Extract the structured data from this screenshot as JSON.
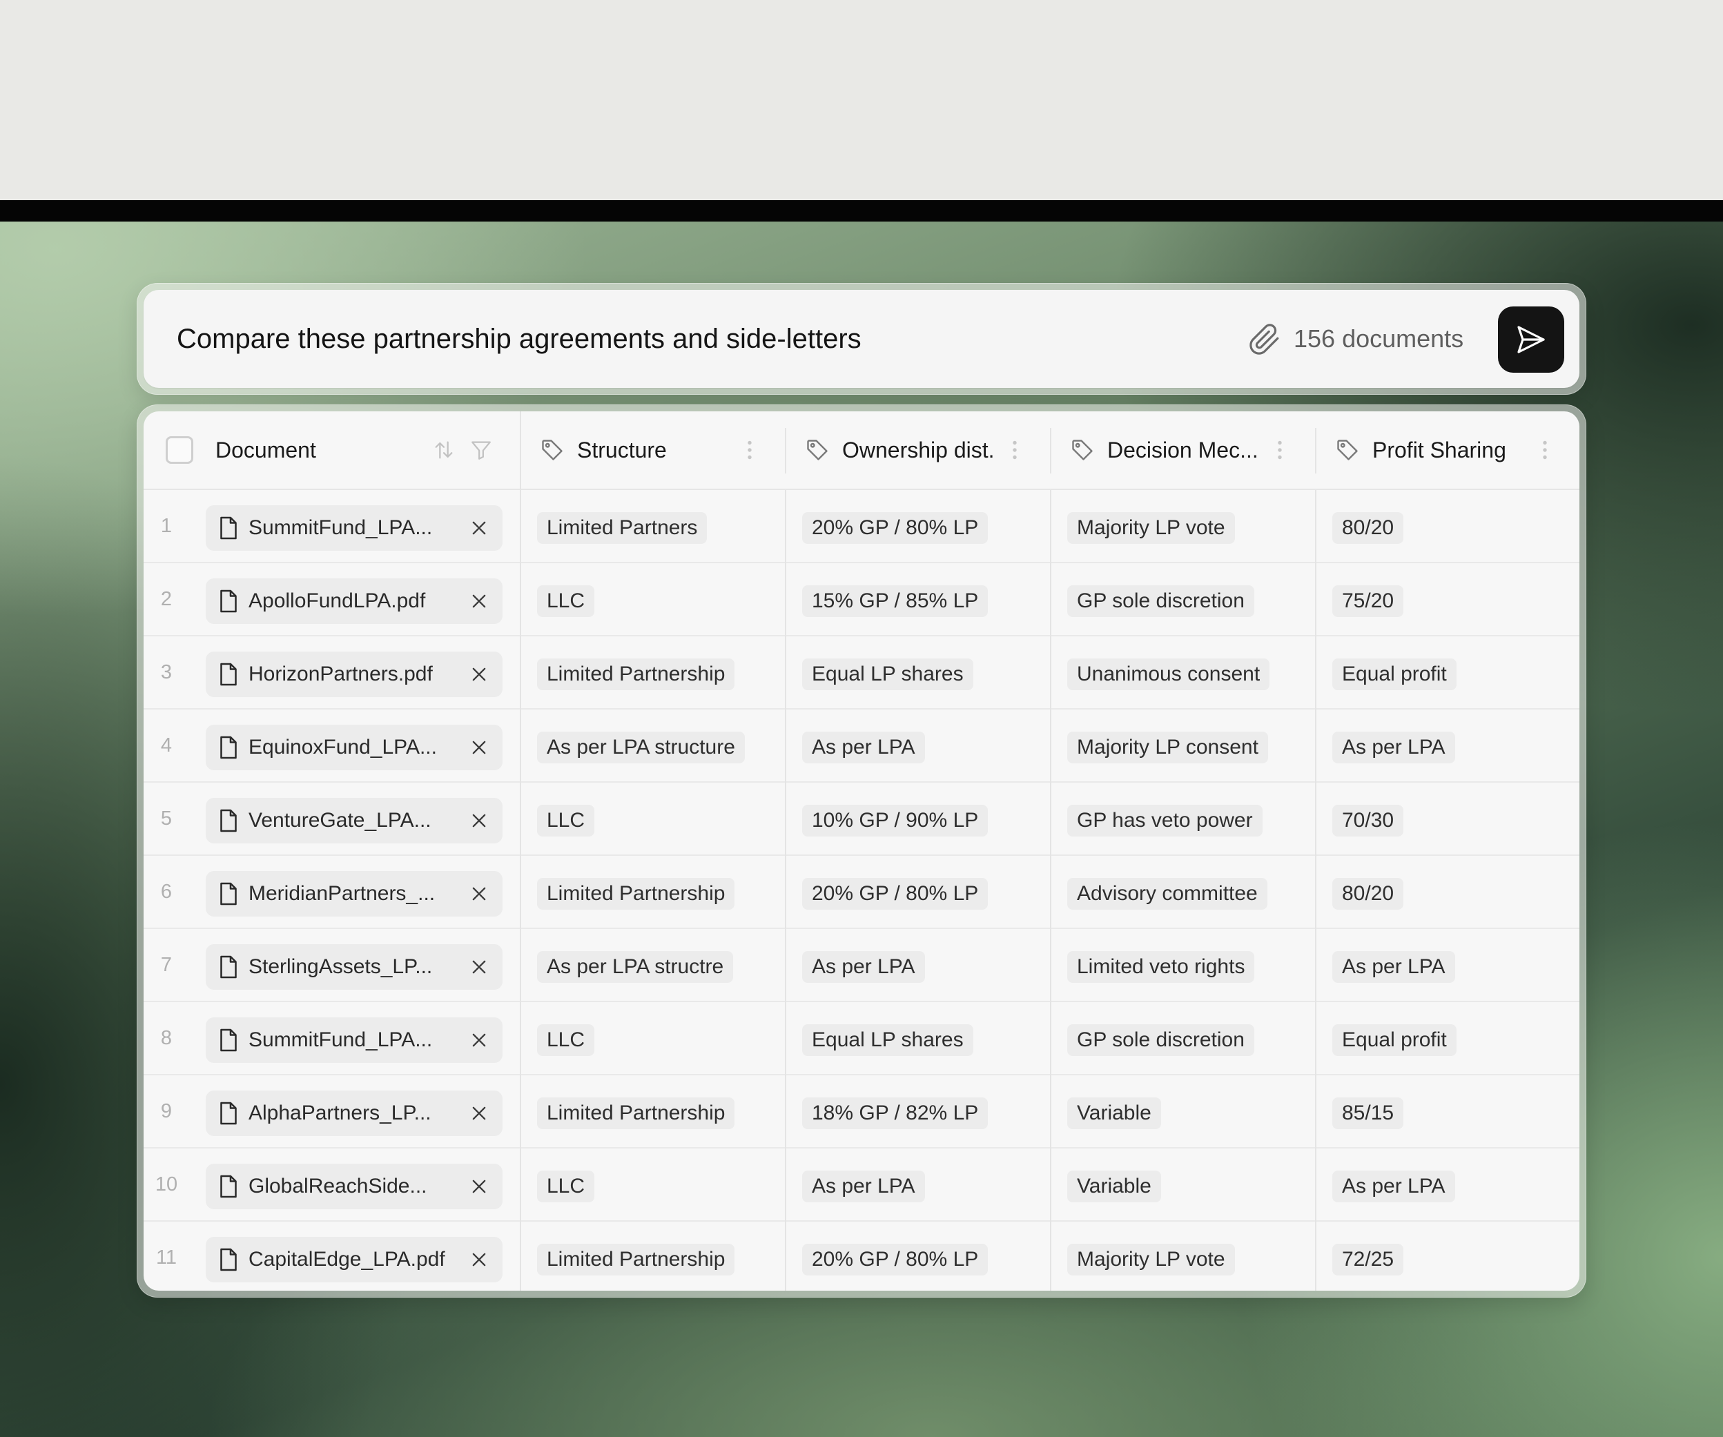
{
  "prompt": {
    "text": "Compare these partnership agreements and side-letters",
    "doc_count": "156 documents",
    "icons": {
      "attach": "paperclip-icon",
      "send": "send-icon"
    }
  },
  "table": {
    "columns": [
      {
        "key": "document",
        "label": "Document"
      },
      {
        "key": "structure",
        "label": "Structure"
      },
      {
        "key": "ownership",
        "label": "Ownership dist."
      },
      {
        "key": "decision",
        "label": "Decision Mec..."
      },
      {
        "key": "profit",
        "label": "Profit Sharing"
      }
    ],
    "rows": [
      {
        "num": "1",
        "document": "SummitFund_LPA...",
        "structure": "Limited Partners",
        "ownership": "20% GP / 80% LP",
        "decision": "Majority LP vote",
        "profit": "80/20"
      },
      {
        "num": "2",
        "document": "ApolloFundLPA.pdf",
        "structure": "LLC",
        "ownership": "15% GP / 85% LP",
        "decision": "GP sole discretion",
        "profit": "75/20"
      },
      {
        "num": "3",
        "document": "HorizonPartners.pdf",
        "structure": "Limited Partnership",
        "ownership": "Equal LP shares",
        "decision": "Unanimous consent",
        "profit": "Equal profit"
      },
      {
        "num": "4",
        "document": "EquinoxFund_LPA...",
        "structure": "As per LPA structure",
        "ownership": "As per LPA",
        "decision": "Majority LP consent",
        "profit": "As per LPA"
      },
      {
        "num": "5",
        "document": "VentureGate_LPA...",
        "structure": "LLC",
        "ownership": "10% GP / 90% LP",
        "decision": "GP has veto power",
        "profit": "70/30"
      },
      {
        "num": "6",
        "document": "MeridianPartners_...",
        "structure": "Limited Partnership",
        "ownership": "20% GP / 80% LP",
        "decision": "Advisory committee",
        "profit": "80/20"
      },
      {
        "num": "7",
        "document": "SterlingAssets_LP...",
        "structure": "As per LPA structre",
        "ownership": "As per LPA",
        "decision": "Limited veto rights",
        "profit": "As per LPA"
      },
      {
        "num": "8",
        "document": "SummitFund_LPA...",
        "structure": "LLC",
        "ownership": "Equal LP shares",
        "decision": "GP sole discretion",
        "profit": "Equal profit"
      },
      {
        "num": "9",
        "document": "AlphaPartners_LP...",
        "structure": "Limited Partnership",
        "ownership": "18% GP / 82% LP",
        "decision": "Variable",
        "profit": "85/15"
      },
      {
        "num": "10",
        "document": "GlobalReachSide...",
        "structure": "LLC",
        "ownership": "As per LPA",
        "decision": "Variable",
        "profit": "As per LPA"
      },
      {
        "num": "11",
        "document": "CapitalEdge_LPA.pdf",
        "structure": "Limited Partnership",
        "ownership": "20% GP / 80% LP",
        "decision": "Majority LP vote",
        "profit": "72/25"
      }
    ]
  },
  "colors": {
    "send_bg": "#141414",
    "chip_bg": "#ececec",
    "row_border": "#e9e9e9",
    "text": "#1a1a1a"
  }
}
